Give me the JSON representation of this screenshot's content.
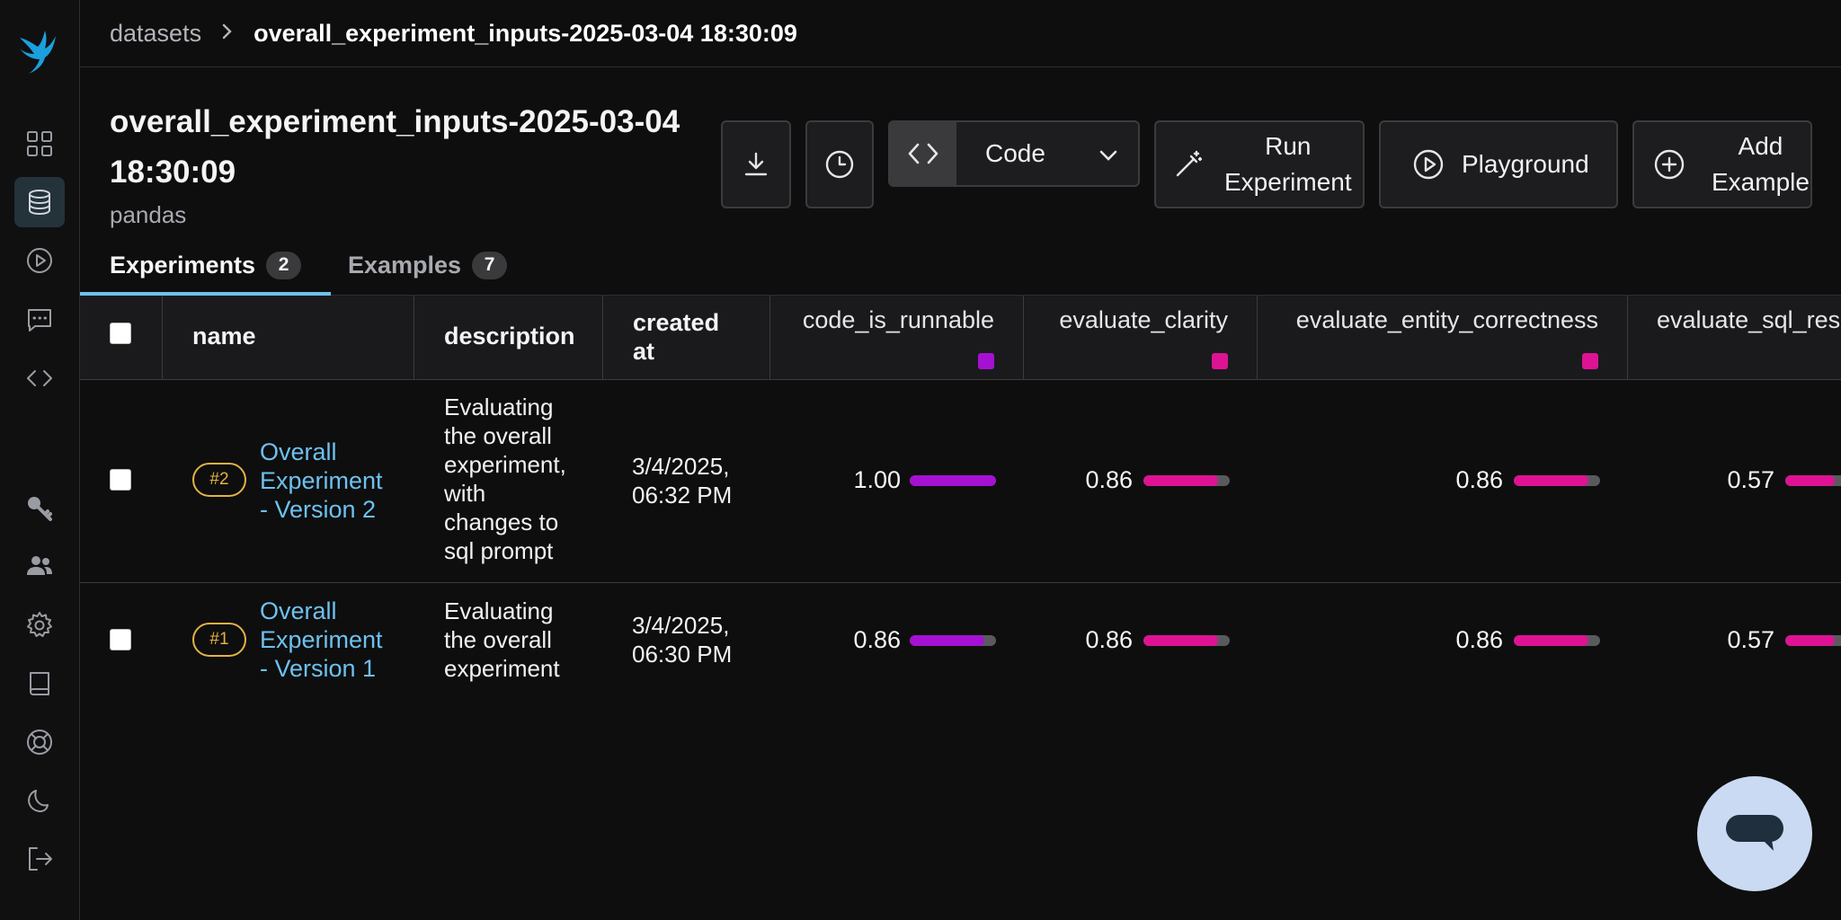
{
  "breadcrumb": {
    "root": "datasets",
    "current": "overall_experiment_inputs-2025-03-04 18:30:09"
  },
  "dataset": {
    "title_line1": "overall_experiment_inputs-2025-03-04",
    "title_line2": "18:30:09",
    "subtitle": "pandas"
  },
  "toolbar": {
    "code_label": "Code",
    "run_line1": "Run",
    "run_line2": "Experiment",
    "playground_label": "Playground",
    "add_line1": "Add",
    "add_line2": "Example"
  },
  "tabs": [
    {
      "label": "Experiments",
      "count": "2"
    },
    {
      "label": "Examples",
      "count": "7"
    }
  ],
  "table": {
    "headers": {
      "name": "name",
      "description": "description",
      "created_line1": "created",
      "created_line2": "at",
      "metrics": [
        "code_is_runnable",
        "evaluate_clarity",
        "evaluate_entity_correctness",
        "evaluate_sql_res"
      ]
    },
    "metric_colors": [
      "#a511d3",
      "#dd1394",
      "#dd1394",
      "#dd1394"
    ],
    "rows": [
      {
        "seq": "#2",
        "name_lines": [
          "Overall",
          "Experiment",
          "- Version 2"
        ],
        "desc_lines": [
          "Evaluating",
          "the overall",
          "experiment,",
          "with",
          "changes to",
          "sql prompt"
        ],
        "created_lines": [
          "3/4/2025,",
          "06:32 PM"
        ],
        "scores": [
          "1.00",
          "0.86",
          "0.86",
          "0.57"
        ],
        "fractions": [
          1.0,
          0.86,
          0.86,
          0.57
        ]
      },
      {
        "seq": "#1",
        "name_lines": [
          "Overall",
          "Experiment",
          "- Version 1"
        ],
        "desc_lines": [
          "Evaluating",
          "the overall",
          "experiment"
        ],
        "created_lines": [
          "3/4/2025,",
          "06:30 PM"
        ],
        "scores": [
          "0.86",
          "0.86",
          "0.86",
          "0.57"
        ],
        "fractions": [
          0.86,
          0.86,
          0.86,
          0.57
        ]
      }
    ]
  },
  "colors": {
    "accent": "#6ec1ee",
    "sequence_badge": "#e3b341",
    "bar_track": "#5a5a5e"
  }
}
